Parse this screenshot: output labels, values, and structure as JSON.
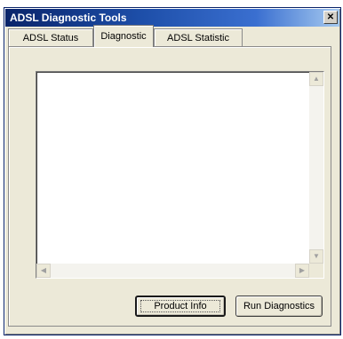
{
  "window": {
    "title": "ADSL Diagnostic Tools",
    "close_glyph": "✕"
  },
  "tabs": [
    {
      "label": "ADSL Status",
      "selected": false
    },
    {
      "label": "Diagnostic",
      "selected": true
    },
    {
      "label": "ADSL Statistic",
      "selected": false
    }
  ],
  "output": {
    "value": ""
  },
  "scrollbars": {
    "up_glyph": "▲",
    "down_glyph": "▼",
    "left_glyph": "◀",
    "right_glyph": "▶"
  },
  "buttons": {
    "product_info": "Product Info",
    "run_diagnostics": "Run Diagnostics"
  },
  "colors": {
    "titlebar": "#0a246a",
    "face": "#ece9d8"
  }
}
